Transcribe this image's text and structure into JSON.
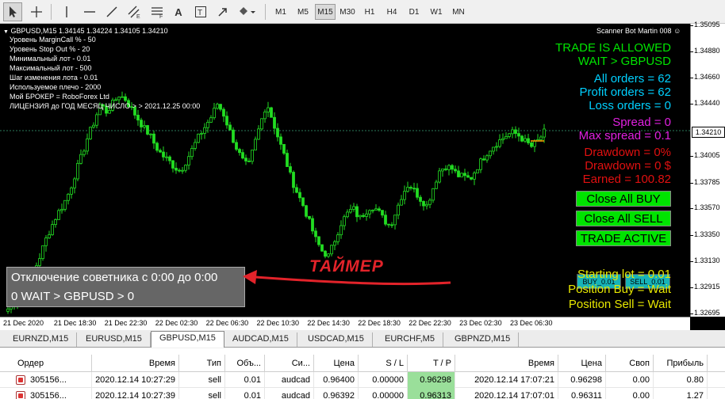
{
  "toolbar": {
    "timeframes": [
      "M1",
      "M5",
      "M15",
      "M30",
      "H1",
      "H4",
      "D1",
      "W1",
      "MN"
    ],
    "selected_timeframe": "M15"
  },
  "chart": {
    "symbol_line": "GBPUSD,M15  1.34145 1.34224 1.34105 1.34210",
    "scanner_title": "Scanner Bot Martin 008",
    "info_lines": [
      "Уровень MarginCall % -  50",
      "Уровень Stop Out % -  20",
      "Минимальный лот -  0.01",
      "Максимальный лот -  500",
      "Шаг изменения лота -  0.01",
      "Используемое плечо -  2000",
      "Мой БРОКЕР  =  RoboForex Ltd",
      "ЛИЦЕНЗИЯ до ГОД  МЕСЯЦ  ЧИСЛО  > >  2021.12.25 00:00"
    ],
    "status": {
      "trade_allowed": "TRADE IS ALLOWED",
      "wait": "WAIT > GBPUSD",
      "all_orders": "All orders = 62",
      "profit_orders": "Profit orders = 62",
      "loss_orders": "Loss orders = 0",
      "spread": "Spread =  0",
      "max_spread": "Max spread =  0.1",
      "drawdown_pct": "Drawdown = 0%",
      "drawdown_usd": "Drawdown = 0 $",
      "earned": "Earned = 100.82",
      "starting_lot": "Starting lot = 0.01",
      "position_buy": "Position Buy  = Wait",
      "position_sell": "Position Sell = Wait"
    },
    "buttons": {
      "close_buy": "Close All BUY",
      "close_sell": "Close All SELL",
      "trade_active": "TRADE ACTIVE",
      "buy_lot": "BUY_0.01",
      "sell_lot": "SELL_0.01"
    },
    "timer_box": {
      "line1": "Отключение советника с 0:00 до 0:00",
      "line2": "0 WAIT > GBPUSD > 0"
    },
    "timer_label": "ТАЙМЕР",
    "current_price": "1.34210",
    "colors": {
      "green": "#00e400",
      "cyan": "#00d0ff",
      "magenta": "#e020e0",
      "red": "#e01010",
      "yellow": "#e8e800",
      "candle": "#22dd22"
    }
  },
  "chart_data": {
    "type": "candlestick",
    "symbol": "GBPUSD",
    "timeframe": "M15",
    "ylim": [
      1.32695,
      1.35095
    ],
    "y_ticks": [
      "1.35095",
      "1.34880",
      "1.34660",
      "1.34440",
      "1.34210",
      "1.34005",
      "1.33785",
      "1.33570",
      "1.33350",
      "1.33130",
      "1.32915",
      "1.32695"
    ],
    "x_ticks": [
      "21 Dec 2020",
      "21 Dec 18:30",
      "21 Dec 22:30",
      "22 Dec 02:30",
      "22 Dec 06:30",
      "22 Dec 10:30",
      "22 Dec 14:30",
      "22 Dec 18:30",
      "22 Dec 22:30",
      "23 Dec 02:30",
      "23 Dec 06:30"
    ],
    "close_series": [
      1.3274,
      1.3281,
      1.3289,
      1.3293,
      1.3303,
      1.3315,
      1.333,
      1.3342,
      1.3353,
      1.3361,
      1.3372,
      1.3388,
      1.3402,
      1.3418,
      1.343,
      1.3445,
      1.3438,
      1.3445,
      1.3452,
      1.3449,
      1.3441,
      1.3433,
      1.3425,
      1.3419,
      1.3409,
      1.3402,
      1.3398,
      1.3392,
      1.3389,
      1.3398,
      1.3408,
      1.3418,
      1.3426,
      1.3434,
      1.3445,
      1.3436,
      1.3422,
      1.3409,
      1.3398,
      1.3392,
      1.3411,
      1.3429,
      1.3446,
      1.343,
      1.3414,
      1.3399,
      1.3382,
      1.337,
      1.3359,
      1.3345,
      1.3331,
      1.3322,
      1.3318,
      1.3331,
      1.3345,
      1.3353,
      1.3358,
      1.3349,
      1.3355,
      1.336,
      1.3356,
      1.3348,
      1.3343,
      1.3356,
      1.337,
      1.3378,
      1.3372,
      1.3365,
      1.336,
      1.3375,
      1.3389,
      1.3393,
      1.3391,
      1.3385,
      1.3384,
      1.3382,
      1.3391,
      1.3399,
      1.3406,
      1.3411,
      1.3415,
      1.3419,
      1.3421,
      1.3418,
      1.3413,
      1.3409,
      1.3414,
      1.3421
    ]
  },
  "tabs": [
    "EURNZD,M15",
    "EURUSD,M15",
    "GBPUSD,M15",
    "AUDCAD,M15",
    "USDCAD,M15",
    "EURCHF,M5",
    "GBPNZD,M15"
  ],
  "active_tab": "GBPUSD,M15",
  "table": {
    "headers": [
      "Ордер",
      "Время",
      "Тип",
      "Объ...",
      "Си...",
      "Цена",
      "S / L",
      "T / P",
      "Время",
      "Цена",
      "Своп",
      "Прибыль"
    ],
    "rows": [
      [
        "305156...",
        "2020.12.14 10:27:29",
        "sell",
        "0.01",
        "audcad",
        "0.96400",
        "0.00000",
        "0.96298",
        "2020.12.14 17:07:21",
        "0.96298",
        "0.00",
        "0.80"
      ],
      [
        "305156...",
        "2020.12.14 10:27:39",
        "sell",
        "0.01",
        "audcad",
        "0.96392",
        "0.00000",
        "0.96313",
        "2020.12.14 17:07:01",
        "0.96311",
        "0.00",
        "1.27"
      ]
    ]
  }
}
